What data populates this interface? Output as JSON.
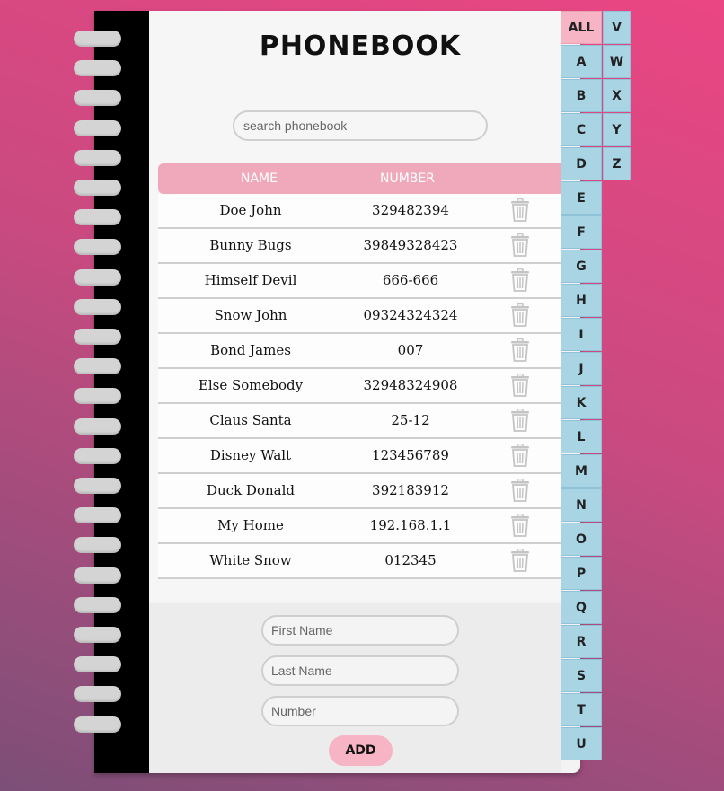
{
  "title": "PHONEBOOK",
  "search": {
    "placeholder": "search phonebook"
  },
  "table": {
    "headers": {
      "name": "NAME",
      "number": "NUMBER"
    },
    "rows": [
      {
        "name": "Doe John",
        "number": "329482394"
      },
      {
        "name": "Bunny Bugs",
        "number": "39849328423"
      },
      {
        "name": "Himself Devil",
        "number": "666-666"
      },
      {
        "name": "Snow John",
        "number": "09324324324"
      },
      {
        "name": "Bond James",
        "number": "007"
      },
      {
        "name": "Else Somebody",
        "number": "32948324908"
      },
      {
        "name": "Claus Santa",
        "number": "25-12"
      },
      {
        "name": "Disney Walt",
        "number": "123456789"
      },
      {
        "name": "Duck Donald",
        "number": "392183912"
      },
      {
        "name": "My Home",
        "number": "192.168.1.1"
      },
      {
        "name": "White Snow",
        "number": "012345"
      }
    ],
    "delete_icon": "trash-icon"
  },
  "form": {
    "first_name_placeholder": "First Name",
    "last_name_placeholder": "Last Name",
    "number_placeholder": "Number",
    "add_label": "ADD"
  },
  "tabs": {
    "active": "ALL",
    "column1": [
      "ALL",
      "A",
      "B",
      "C",
      "D",
      "E",
      "F",
      "G",
      "H",
      "I",
      "J",
      "K",
      "L",
      "M",
      "N",
      "O",
      "P",
      "Q",
      "R",
      "S",
      "T",
      "U"
    ],
    "column2": [
      "V",
      "W",
      "X",
      "Y",
      "Z"
    ]
  },
  "colors": {
    "accent_pink": "#f6b4c4",
    "header_pink": "#f0a8bb",
    "tab_blue": "#a8d4e4",
    "spine": "#000000"
  }
}
